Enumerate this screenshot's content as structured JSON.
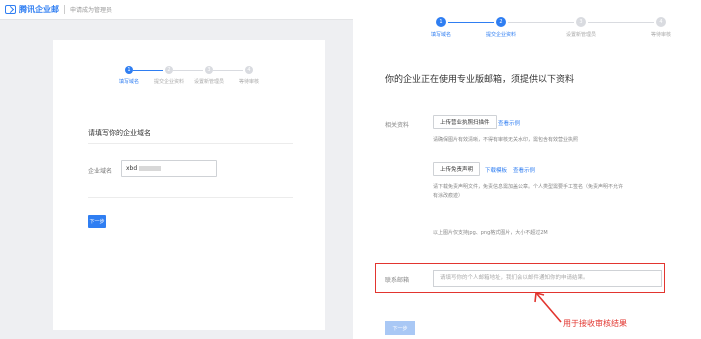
{
  "left": {
    "brand": "腾讯企业邮",
    "brand_sub": "申请成为管理员",
    "steps": [
      "填写域名",
      "提交企业资料",
      "设置新管理员",
      "等待审核"
    ],
    "step_numbers": [
      "1",
      "2",
      "3",
      "4"
    ],
    "title": "请填写你的企业域名",
    "domain_label": "企业域名",
    "domain_value": "xbd",
    "next_label": "下一步"
  },
  "right": {
    "steps": [
      "填写域名",
      "提交企业资料",
      "设置新管理员",
      "等待审核"
    ],
    "step_numbers": [
      "1",
      "2",
      "3",
      "4"
    ],
    "title": "你的企业正在使用专业版邮箱，须提供以下资料",
    "docs_label": "相关资料",
    "upload_license": "上传营业执照扫描件",
    "view_example_1": "查看示例",
    "hint_license": "请确保图片有效清晰，不得有审核无关水印，需包含有效营业执照",
    "upload_statement": "上传免责声明",
    "download_template": "下载模板",
    "view_example_2": "查看示例",
    "hint_statement_1": "请下载免责声明文件，免责信息需加盖公章。个人类型需要手工签名（免责声明不允许",
    "hint_statement_2": "有涂改痕迹）",
    "hint_format": "以上图片仅支持jpg、png格式图片，大小不超过2M",
    "email_label": "联系邮箱",
    "email_placeholder": "请填写你的个人邮箱地址，我们会以邮件通知你的申请结果。",
    "next_label": "下一步",
    "annotation": "用于接收审核结果"
  },
  "colors": {
    "accent": "#2f7ef2",
    "highlight": "#e2352f"
  }
}
